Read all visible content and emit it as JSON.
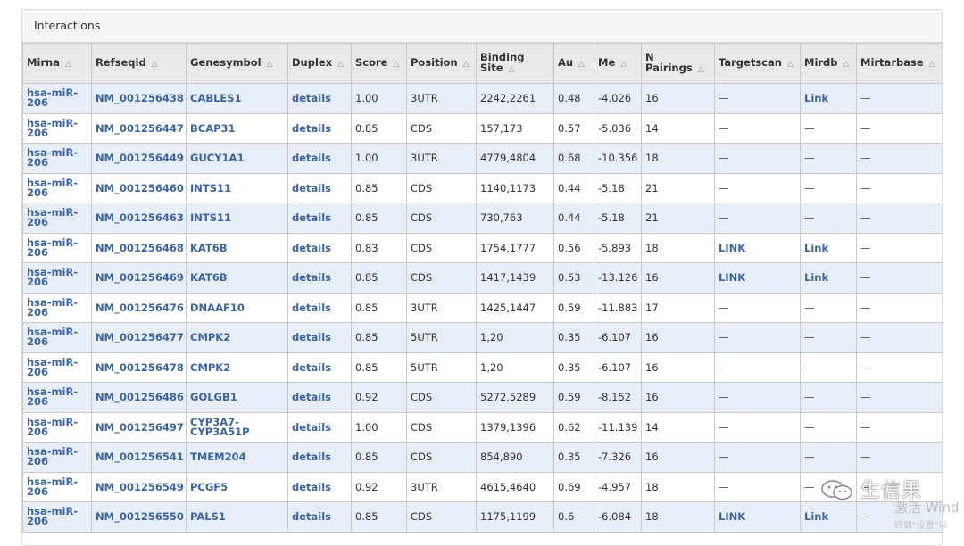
{
  "panel": {
    "title": "Interactions"
  },
  "table": {
    "columns": [
      {
        "key": "mirna",
        "label": "Mirna"
      },
      {
        "key": "refseqid",
        "label": "Refseqid"
      },
      {
        "key": "genesymbol",
        "label": "Genesymbol"
      },
      {
        "key": "duplex",
        "label": "Duplex"
      },
      {
        "key": "score",
        "label": "Score"
      },
      {
        "key": "position",
        "label": "Position"
      },
      {
        "key": "binding_site",
        "label": "Binding Site"
      },
      {
        "key": "au",
        "label": "Au"
      },
      {
        "key": "me",
        "label": "Me"
      },
      {
        "key": "n_pairings",
        "label": "N Pairings"
      },
      {
        "key": "targetscan",
        "label": "Targetscan"
      },
      {
        "key": "mirdb",
        "label": "Mirdb"
      },
      {
        "key": "mirtarbase",
        "label": "Mirtarbase"
      }
    ],
    "rows": [
      {
        "mirna": "hsa-miR-206",
        "refseqid": "NM_001256438",
        "genesymbol": "CABLES1",
        "duplex": "details",
        "score": "1.00",
        "position": "3UTR",
        "binding_site": "2242,2261",
        "au": "0.48",
        "me": "-4.026",
        "n_pairings": "16",
        "targetscan": "—",
        "mirdb": "Link",
        "mirtarbase": "—"
      },
      {
        "mirna": "hsa-miR-206",
        "refseqid": "NM_001256447",
        "genesymbol": "BCAP31",
        "duplex": "details",
        "score": "0.85",
        "position": "CDS",
        "binding_site": "157,173",
        "au": "0.57",
        "me": "-5.036",
        "n_pairings": "14",
        "targetscan": "—",
        "mirdb": "—",
        "mirtarbase": "—"
      },
      {
        "mirna": "hsa-miR-206",
        "refseqid": "NM_001256449",
        "genesymbol": "GUCY1A1",
        "duplex": "details",
        "score": "1.00",
        "position": "3UTR",
        "binding_site": "4779,4804",
        "au": "0.68",
        "me": "-10.356",
        "n_pairings": "18",
        "targetscan": "—",
        "mirdb": "—",
        "mirtarbase": "—"
      },
      {
        "mirna": "hsa-miR-206",
        "refseqid": "NM_001256460",
        "genesymbol": "INTS11",
        "duplex": "details",
        "score": "0.85",
        "position": "CDS",
        "binding_site": "1140,1173",
        "au": "0.44",
        "me": "-5.18",
        "n_pairings": "21",
        "targetscan": "—",
        "mirdb": "—",
        "mirtarbase": "—"
      },
      {
        "mirna": "hsa-miR-206",
        "refseqid": "NM_001256463",
        "genesymbol": "INTS11",
        "duplex": "details",
        "score": "0.85",
        "position": "CDS",
        "binding_site": "730,763",
        "au": "0.44",
        "me": "-5.18",
        "n_pairings": "21",
        "targetscan": "—",
        "mirdb": "—",
        "mirtarbase": "—"
      },
      {
        "mirna": "hsa-miR-206",
        "refseqid": "NM_001256468",
        "genesymbol": "KAT6B",
        "duplex": "details",
        "score": "0.83",
        "position": "CDS",
        "binding_site": "1754,1777",
        "au": "0.56",
        "me": "-5.893",
        "n_pairings": "18",
        "targetscan": "LINK",
        "mirdb": "Link",
        "mirtarbase": "—"
      },
      {
        "mirna": "hsa-miR-206",
        "refseqid": "NM_001256469",
        "genesymbol": "KAT6B",
        "duplex": "details",
        "score": "0.85",
        "position": "CDS",
        "binding_site": "1417,1439",
        "au": "0.53",
        "me": "-13.126",
        "n_pairings": "16",
        "targetscan": "LINK",
        "mirdb": "Link",
        "mirtarbase": "—"
      },
      {
        "mirna": "hsa-miR-206",
        "refseqid": "NM_001256476",
        "genesymbol": "DNAAF10",
        "duplex": "details",
        "score": "0.85",
        "position": "3UTR",
        "binding_site": "1425,1447",
        "au": "0.59",
        "me": "-11.883",
        "n_pairings": "17",
        "targetscan": "—",
        "mirdb": "—",
        "mirtarbase": "—"
      },
      {
        "mirna": "hsa-miR-206",
        "refseqid": "NM_001256477",
        "genesymbol": "CMPK2",
        "duplex": "details",
        "score": "0.85",
        "position": "5UTR",
        "binding_site": "1,20",
        "au": "0.35",
        "me": "-6.107",
        "n_pairings": "16",
        "targetscan": "—",
        "mirdb": "—",
        "mirtarbase": "—"
      },
      {
        "mirna": "hsa-miR-206",
        "refseqid": "NM_001256478",
        "genesymbol": "CMPK2",
        "duplex": "details",
        "score": "0.85",
        "position": "5UTR",
        "binding_site": "1,20",
        "au": "0.35",
        "me": "-6.107",
        "n_pairings": "16",
        "targetscan": "—",
        "mirdb": "—",
        "mirtarbase": "—"
      },
      {
        "mirna": "hsa-miR-206",
        "refseqid": "NM_001256486",
        "genesymbol": "GOLGB1",
        "duplex": "details",
        "score": "0.92",
        "position": "CDS",
        "binding_site": "5272,5289",
        "au": "0.59",
        "me": "-8.152",
        "n_pairings": "16",
        "targetscan": "—",
        "mirdb": "—",
        "mirtarbase": "—"
      },
      {
        "mirna": "hsa-miR-206",
        "refseqid": "NM_001256497",
        "genesymbol": "CYP3A7-CYP3A51P",
        "duplex": "details",
        "score": "1.00",
        "position": "CDS",
        "binding_site": "1379,1396",
        "au": "0.62",
        "me": "-11.139",
        "n_pairings": "14",
        "targetscan": "—",
        "mirdb": "—",
        "mirtarbase": "—"
      },
      {
        "mirna": "hsa-miR-206",
        "refseqid": "NM_001256541",
        "genesymbol": "TMEM204",
        "duplex": "details",
        "score": "0.85",
        "position": "CDS",
        "binding_site": "854,890",
        "au": "0.35",
        "me": "-7.326",
        "n_pairings": "16",
        "targetscan": "—",
        "mirdb": "—",
        "mirtarbase": "—"
      },
      {
        "mirna": "hsa-miR-206",
        "refseqid": "NM_001256549",
        "genesymbol": "PCGF5",
        "duplex": "details",
        "score": "0.92",
        "position": "3UTR",
        "binding_site": "4615,4640",
        "au": "0.69",
        "me": "-4.957",
        "n_pairings": "18",
        "targetscan": "—",
        "mirdb": "—",
        "mirtarbase": "—"
      },
      {
        "mirna": "hsa-miR-206",
        "refseqid": "NM_001256550",
        "genesymbol": "PALS1",
        "duplex": "details",
        "score": "0.85",
        "position": "CDS",
        "binding_site": "1175,1199",
        "au": "0.6",
        "me": "-6.084",
        "n_pairings": "18",
        "targetscan": "LINK",
        "mirdb": "Link",
        "mirtarbase": "—"
      }
    ]
  },
  "watermark": {
    "brand": "生信果",
    "activate": "激活 Wind",
    "activate_sub": "转到\"设置\"以"
  },
  "colors": {
    "link": "#3c64a4",
    "row_stripe": "#e8eef8",
    "header_bg": "#e9e9e9"
  },
  "icons": {
    "sort": "sort-triangle-icon",
    "watermark_logo": "wechat-logo-icon"
  }
}
